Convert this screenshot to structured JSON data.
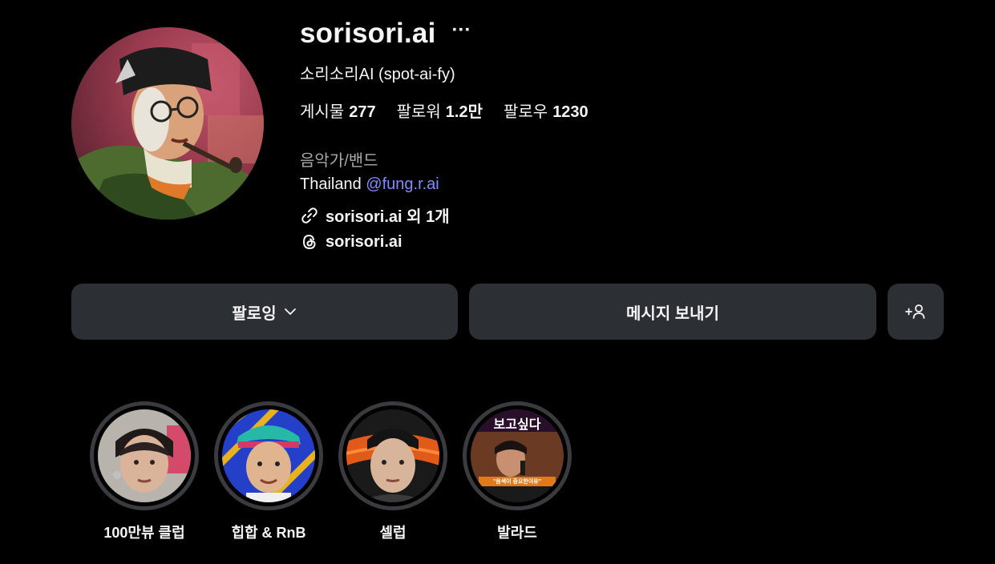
{
  "profile": {
    "username": "sorisori.ai",
    "more_label": "···",
    "full_name": "소리소리AI (spot-ai-fy)",
    "stats": {
      "posts_label": "게시물",
      "posts": "277",
      "followers_label": "팔로워",
      "followers": "1.2만",
      "following_label": "팔로우",
      "following": "1230"
    },
    "category": "음악가/밴드",
    "bio_text": "Thailand ",
    "bio_mention": "@fung.r.ai",
    "link_text": "sorisori.ai 외 1개",
    "threads_text": "sorisori.ai"
  },
  "actions": {
    "following_label": "팔로잉",
    "message_label": "메시지 보내기",
    "add_icon": "add-person-icon"
  },
  "highlights": [
    {
      "label": "100만뷰 클럽"
    },
    {
      "label": "힙합 & RnB"
    },
    {
      "label": "셀럽"
    },
    {
      "label": "발라드",
      "overlay_top": "보고싶다",
      "overlay_bottom": "\"음색이 중요한이유\""
    }
  ],
  "colors": {
    "background": "#000000",
    "button": "#2c2f34",
    "mention": "#7f8dff",
    "muted": "#a8a8a8"
  }
}
